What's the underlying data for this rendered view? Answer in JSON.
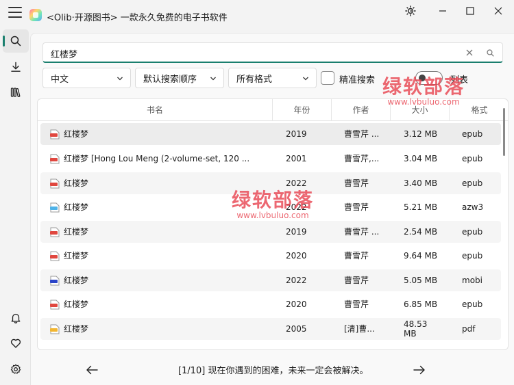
{
  "app": {
    "title": "<Olib·开源图书> 一款永久免费的电子书软件"
  },
  "icons": {
    "menu": "hamburger-icon",
    "theme": "theme-sun-icon",
    "minimize": "minimize-icon",
    "maximize": "maximize-icon",
    "close": "close-icon",
    "search": "search-icon",
    "download": "download-icon",
    "library": "library-icon",
    "notifications": "bell-icon",
    "favorites": "heart-icon",
    "settings": "gear-icon"
  },
  "search": {
    "query": "红楼梦"
  },
  "filters": {
    "language": "中文",
    "sort": "默认搜索顺序",
    "format": "所有格式",
    "exact_label": "精准搜索",
    "exact_checked": false,
    "list_label": "列表",
    "list_on": false
  },
  "table": {
    "columns": [
      "书名",
      "年份",
      "作者",
      "大小",
      "格式"
    ],
    "rows": [
      {
        "name": "红楼梦",
        "year": "2019",
        "author": "曹雪芹 ...",
        "size": "3.12 MB",
        "format": "epub"
      },
      {
        "name": "红楼梦 [Hong Lou Meng (2-volume-set, 120 ...",
        "year": "2001",
        "author": "曹雪芹,...",
        "size": "3.04 MB",
        "format": "epub"
      },
      {
        "name": "红楼梦",
        "year": "2022",
        "author": "曹雪芹",
        "size": "3.40 MB",
        "format": "epub"
      },
      {
        "name": "红楼梦",
        "year": "2022",
        "author": "曹雪芹",
        "size": "5.21 MB",
        "format": "azw3"
      },
      {
        "name": "红楼梦",
        "year": "2019",
        "author": "曹雪芹 ...",
        "size": "2.54 MB",
        "format": "epub"
      },
      {
        "name": "红楼梦",
        "year": "2020",
        "author": "曹雪芹",
        "size": "9.64 MB",
        "format": "epub"
      },
      {
        "name": "红楼梦",
        "year": "2022",
        "author": "曹雪芹",
        "size": "5.05 MB",
        "format": "mobi"
      },
      {
        "name": "红楼梦",
        "year": "2020",
        "author": "曹雪芹",
        "size": "6.85 MB",
        "format": "epub"
      },
      {
        "name": "红楼梦",
        "year": "2005",
        "author": "[清]曹...",
        "size_line1": "48.53",
        "size_line2": "MB",
        "format": "pdf"
      }
    ]
  },
  "format_colors": {
    "epub": "#e0473f",
    "azw3": "#4fb3e8",
    "mobi": "#2b44c8",
    "pdf": "#f2b632"
  },
  "pager": {
    "text": "[1/10] 现在你遇到的困难，未来一定会被解决。"
  },
  "watermark": {
    "title": "绿软部落",
    "url": "www.lvbuluo.com",
    "color": "#e8434f"
  },
  "colors": {
    "accent": "#1a7f6e",
    "background": "#f3f3f3"
  }
}
